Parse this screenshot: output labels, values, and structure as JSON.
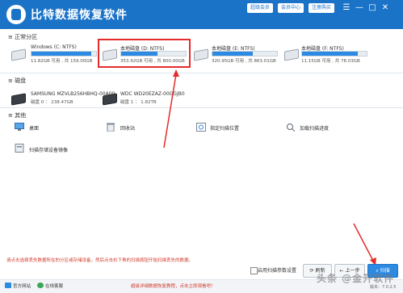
{
  "app": {
    "title": "比特数据恢复软件",
    "top_buttons": [
      "超级会员",
      "会员中心",
      "注册购买"
    ]
  },
  "partitions": {
    "heading": "正常分区",
    "items": [
      {
        "name": "Windows (C: NTFS)",
        "info": "11.82GB 可用 , 共 159.00GB",
        "used_fraction": 0.93
      },
      {
        "name": "本地磁盘 (D: NTFS)",
        "info": "353.92GB 可用 , 共 800.00GB",
        "used_fraction": 0.56
      },
      {
        "name": "本地磁盘 (E: NTFS)",
        "info": "320.95GB 可用 , 共 863.01GB",
        "used_fraction": 0.63
      },
      {
        "name": "本地磁盘 (F: NTFS)",
        "info": "11.15GB 可用 , 共 78.03GB",
        "used_fraction": 0.86
      }
    ]
  },
  "disks": {
    "heading": "磁盘",
    "items": [
      {
        "name": "SAMSUNG MZVLB256HBHQ-00A00",
        "info": "磁盘 0 ： 238.47GB"
      },
      {
        "name": "WDC WD20EZAZ-00GGJB0",
        "info": "磁盘 1 ： 1.82TB"
      }
    ]
  },
  "others": {
    "heading": "其他",
    "items": [
      "桌面",
      "回收站",
      "指定扫描位置",
      "加载扫描进度",
      "扫描存储设备镜像"
    ]
  },
  "bottom": {
    "tip": "请点击选择丢失数据所在的分区或存储设备，然后点击右下角的扫描按钮开始扫描丢失的数据。",
    "checkbox_label": "启用扫描参数设置",
    "refresh": "刷新",
    "back": "上一步",
    "scan": "扫描"
  },
  "footer": {
    "website": "官方网站",
    "online_service": "在线客服",
    "tip": "超级详细数据恢复教程，点击立即观看吧！",
    "version": "版本：7.0.2.5"
  },
  "watermark": "头条 @金开软件",
  "colors": {
    "accent": "#1b73c8",
    "highlight": "#e52b2b",
    "bar": "#2d8ae3"
  }
}
